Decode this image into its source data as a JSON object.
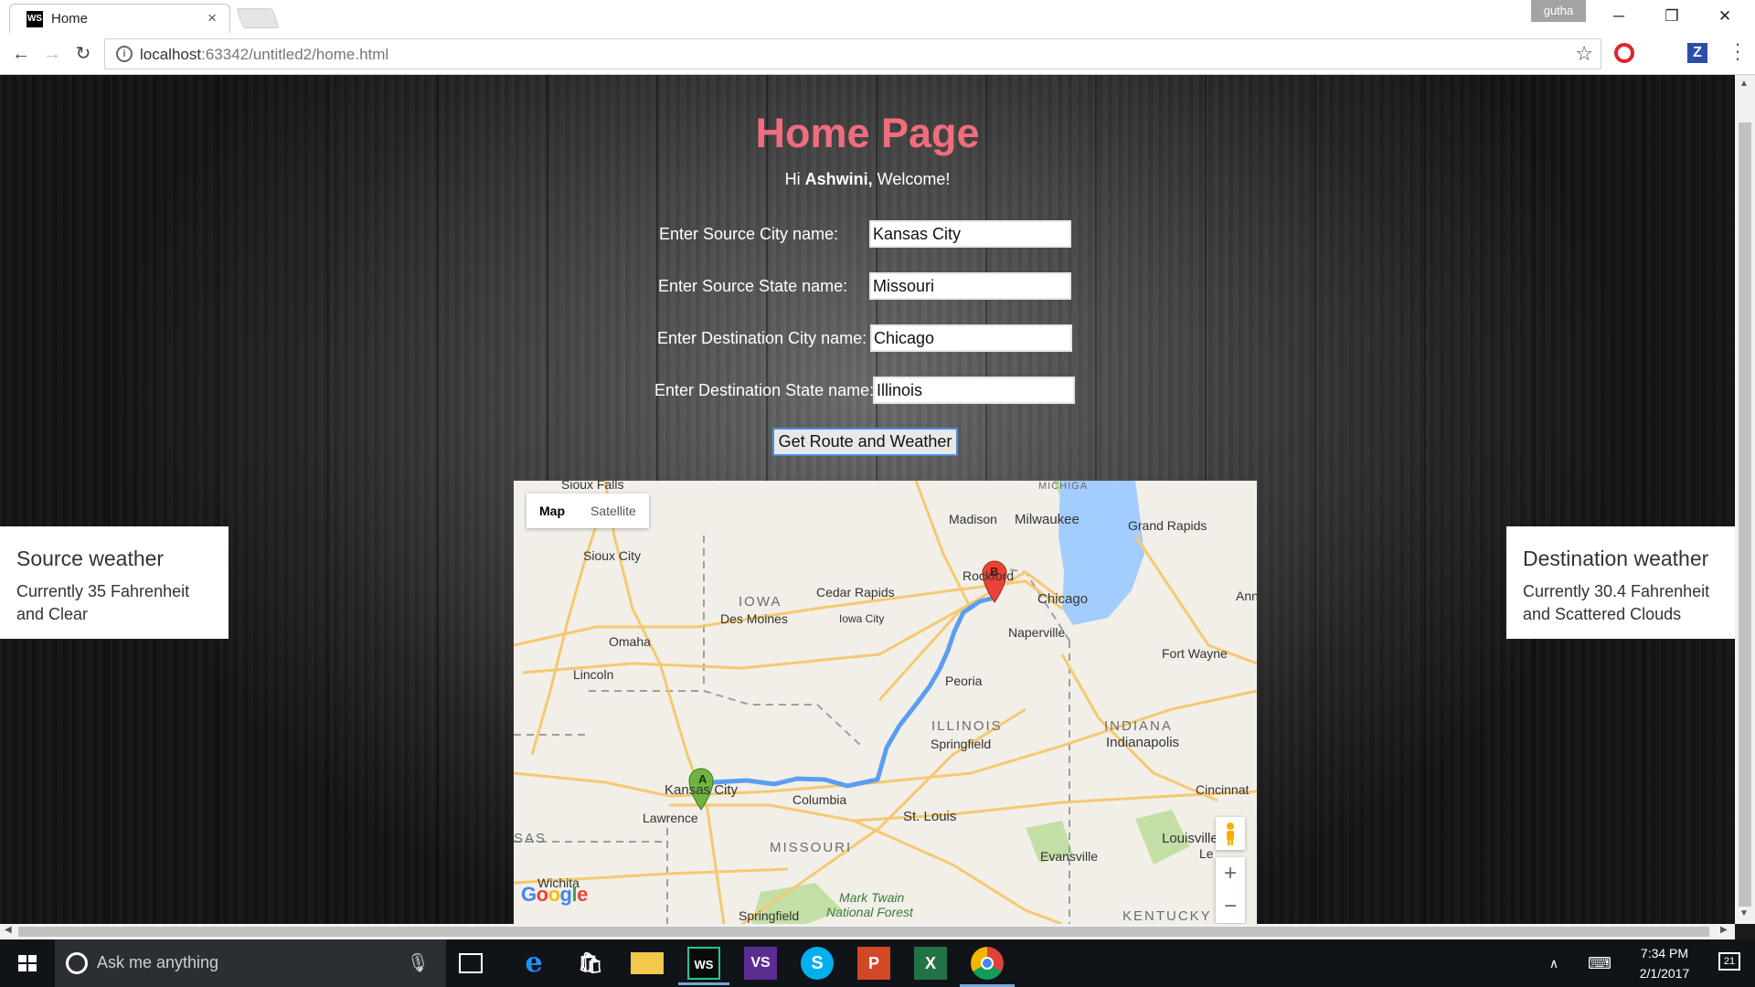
{
  "browser": {
    "tab_title": "Home",
    "tab_favicon_text": "WS",
    "tab_close": "×",
    "profile_name": "gutha",
    "url_host": "localhost",
    "url_rest": ":63342/untitled2/home.html",
    "ext_z_label": "Z"
  },
  "page": {
    "heading": "Home Page",
    "welcome_prefix": "Hi ",
    "user_name": "Ashwini,",
    "welcome_suffix": " Welcome!",
    "form": {
      "source_city_label": "Enter Source City name:",
      "source_city_value": "Kansas City",
      "source_state_label": "Enter Source State name:",
      "source_state_value": "Missouri",
      "dest_city_label": "Enter Destination City name:",
      "dest_city_value": "Chicago",
      "dest_state_label": "Enter Destination State name:",
      "dest_state_value": "Illinois"
    },
    "submit_label": "Get Route and Weather",
    "source_weather": {
      "title": "Source weather",
      "text": "Currently 35 Fahrenheit and Clear"
    },
    "destination_weather": {
      "title": "Destination weather",
      "text": "Currently 30.4 Fahrenheit and Scattered Clouds"
    }
  },
  "map": {
    "type_map": "Map",
    "type_satellite": "Satellite",
    "marker_a": "A",
    "marker_b": "B",
    "zoom_in": "+",
    "zoom_out": "−",
    "labels": {
      "sioux_falls": "Sioux Falls",
      "sioux_city": "Sioux City",
      "iowa": "IOWA",
      "des_moines": "Des Moines",
      "cedar_rapids": "Cedar Rapids",
      "iowa_city": "Iowa City",
      "omaha": "Omaha",
      "lincoln": "Lincoln",
      "madison": "Madison",
      "milwaukee": "Milwaukee",
      "grand_rapids": "Grand Rapids",
      "rockford": "Rockford",
      "chicago": "Chicago",
      "naperville": "Naperville",
      "ann": "Ann",
      "fort_wayne": "Fort Wayne",
      "peoria": "Peoria",
      "illinois": "ILLINOIS",
      "springfield": "Springfield",
      "indiana": "INDIANA",
      "indianapolis": "Indianapolis",
      "kansas_city": "Kansas City",
      "columbia": "Columbia",
      "lawrence": "Lawrence",
      "st_louis": "St. Louis",
      "cincinnati": "Cincinnat",
      "kansas": "SAS",
      "missouri": "MISSOURI",
      "evansville": "Evansville",
      "louisville": "Louisville",
      "lex": "Le",
      "wichita": "Wichita",
      "mark_twain": "Mark Twain",
      "national_forest": "National Forest",
      "springfield_mo": "Springfield",
      "kentucky": "KENTUCKY",
      "michigan": "MICHIGA"
    },
    "colors": {
      "land": "#f2efe8",
      "water": "#a3ccff",
      "road": "#f5c971",
      "route": "#5b9ef1",
      "park": "#c3dfa6"
    }
  },
  "taskbar": {
    "search_placeholder": "Ask me anything",
    "time": "7:34 PM",
    "date": "2/1/2017",
    "notification_count": "21"
  }
}
